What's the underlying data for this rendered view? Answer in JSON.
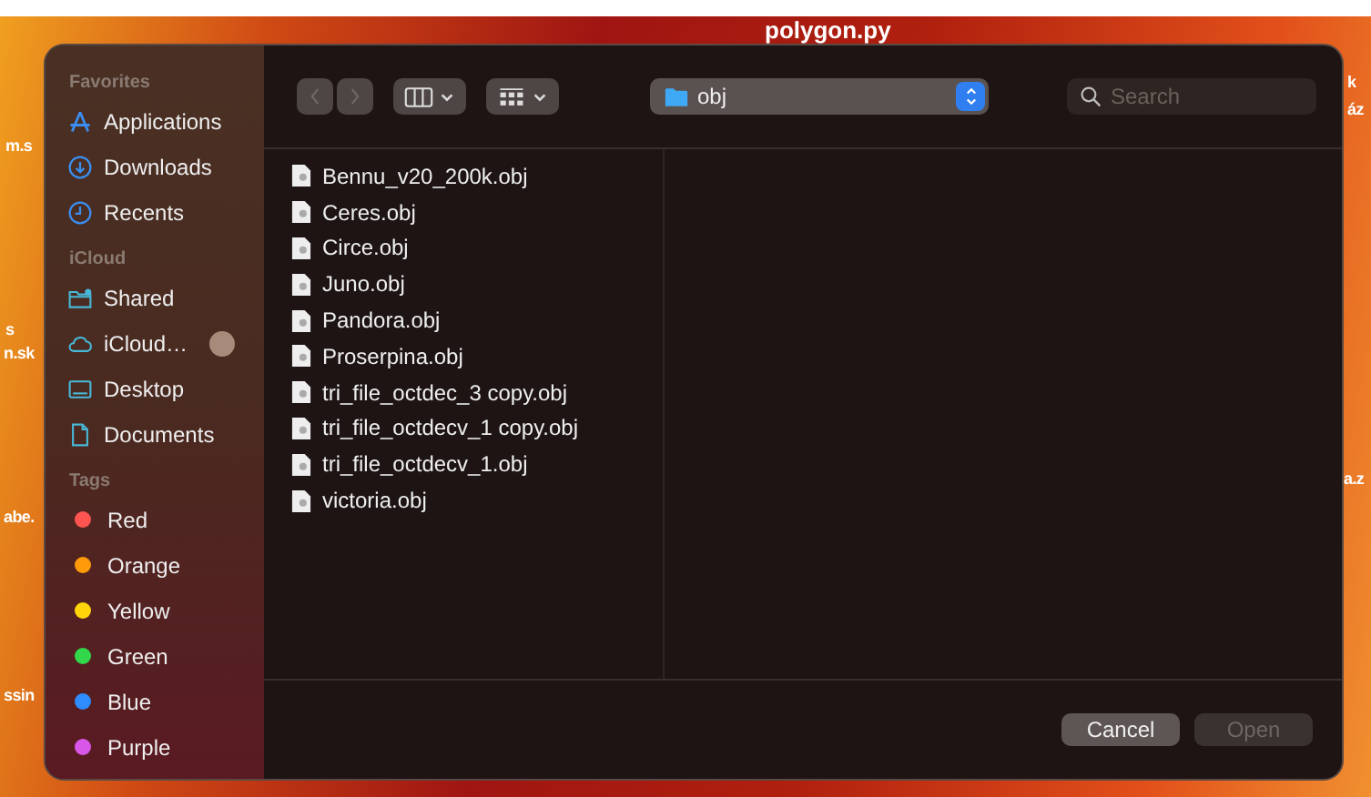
{
  "desktop": {
    "labels": [
      {
        "text": "polygon.py"
      },
      {
        "text": "m.s"
      },
      {
        "text": "s"
      },
      {
        "text": "n.sk"
      },
      {
        "text": "abe."
      },
      {
        "text": "ssin"
      },
      {
        "text": "k"
      },
      {
        "text": "áz"
      },
      {
        "text": "a.z"
      }
    ]
  },
  "sidebar": {
    "sections": [
      {
        "title": "Favorites",
        "items": [
          {
            "label": "Applications"
          },
          {
            "label": "Downloads"
          },
          {
            "label": "Recents"
          }
        ]
      },
      {
        "title": "iCloud",
        "items": [
          {
            "label": "Shared"
          },
          {
            "label": "iCloud…",
            "progress": true
          },
          {
            "label": "Desktop"
          },
          {
            "label": "Documents"
          }
        ]
      },
      {
        "title": "Tags",
        "items": [
          {
            "label": "Red",
            "color": "#ff5550"
          },
          {
            "label": "Orange",
            "color": "#ff9a0a"
          },
          {
            "label": "Yellow",
            "color": "#ffd60a"
          },
          {
            "label": "Green",
            "color": "#32d74b"
          },
          {
            "label": "Blue",
            "color": "#2e8cff"
          },
          {
            "label": "Purple",
            "color": "#d957e8"
          }
        ]
      }
    ]
  },
  "toolbar": {
    "nav": [
      {
        "kind": "back",
        "disabled": true
      },
      {
        "kind": "forward",
        "disabled": true
      }
    ],
    "views": [
      {
        "kind": "columns"
      },
      {
        "kind": "grid"
      }
    ],
    "location": "obj",
    "search": {
      "placeholder": "Search"
    }
  },
  "files": [
    {
      "name": "Bennu_v20_200k.obj"
    },
    {
      "name": "Ceres.obj"
    },
    {
      "name": "Circe.obj"
    },
    {
      "name": "Juno.obj"
    },
    {
      "name": "Pandora.obj"
    },
    {
      "name": "Proserpina.obj"
    },
    {
      "name": "tri_file_octdec_3 copy.obj"
    },
    {
      "name": "tri_file_octdecv_1 copy.obj"
    },
    {
      "name": "tri_file_octdecv_1.obj"
    },
    {
      "name": "victoria.obj"
    }
  ],
  "buttons": [
    {
      "label": "Cancel",
      "disabled": false
    },
    {
      "label": "Open",
      "disabled": true
    }
  ]
}
